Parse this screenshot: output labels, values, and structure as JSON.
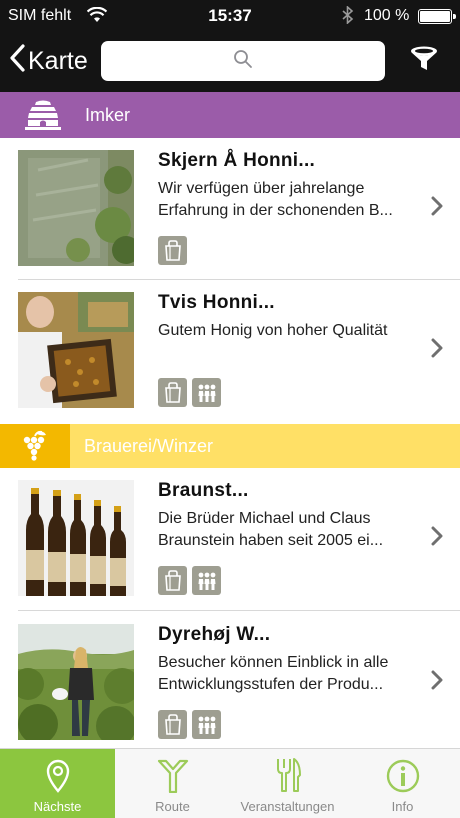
{
  "status_bar": {
    "carrier": "SIM fehlt",
    "time": "15:37",
    "battery": "100 %"
  },
  "nav": {
    "back_label": "Karte",
    "search_placeholder": "",
    "icons": {
      "back": "chevron-left-icon",
      "search": "search-icon",
      "filter": "filter-funnel-icon"
    }
  },
  "sections": [
    {
      "label": "Imker",
      "icon": "beehive-icon",
      "color": "#9b5ca9",
      "items": [
        {
          "title": "Skjern Å Honni...",
          "description": "Wir verfügen über jahrelange Erfahrung in der schonenden B...",
          "badges": [
            "shopping-bag-icon"
          ]
        },
        {
          "title": "Tvis Honni...",
          "description": "Gutem Honig von hoher Qualität",
          "badges": [
            "shopping-bag-icon",
            "group-people-icon"
          ]
        }
      ]
    },
    {
      "label": "Brauerei/Winzer",
      "icon": "grapes-icon",
      "color": "#ffe066",
      "accent": "#f3b800",
      "items": [
        {
          "title": "Braunst...",
          "description": "Die Brüder Michael und Claus Braunstein haben seit 2005 ei...",
          "badges": [
            "shopping-bag-icon",
            "group-people-icon"
          ]
        },
        {
          "title": "Dyrehøj W...",
          "description": "Besucher können Einblick in alle Entwicklungsstufen der Produ...",
          "badges": [
            "shopping-bag-icon",
            "group-people-icon"
          ]
        }
      ]
    }
  ],
  "tabs": [
    {
      "label": "Nächste",
      "icon": "location-pin-icon",
      "active": true
    },
    {
      "label": "Route",
      "icon": "route-fork-icon",
      "active": false
    },
    {
      "label": "Veranstaltungen",
      "icon": "fork-knife-icon",
      "active": false
    },
    {
      "label": "Info",
      "icon": "info-icon",
      "active": false
    }
  ],
  "colors": {
    "accent_green": "#8cc63f",
    "imker_purple": "#9b5ca9",
    "brauerei_yellow": "#ffe066",
    "badge_gray": "#9e9e91"
  }
}
